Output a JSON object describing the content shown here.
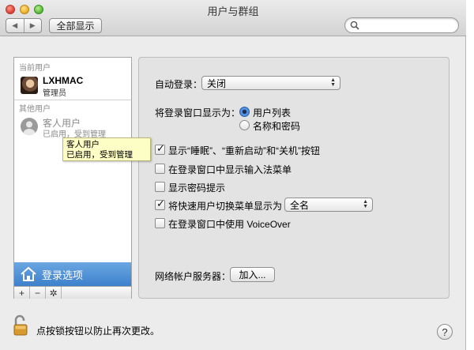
{
  "window": {
    "title": "用户与群组"
  },
  "toolbar": {
    "show_all": "全部显示",
    "back": "◀",
    "forward": "▶",
    "search_placeholder": ""
  },
  "sidebar": {
    "current_users_header": "当前用户",
    "current_user": {
      "name": "LXHMAC",
      "role": "管理员"
    },
    "other_users_header": "其他用户",
    "guest_user": {
      "name": "客人用户",
      "status": "已启用，受到管理"
    },
    "login_options": "登录选项",
    "add": "+",
    "remove": "−",
    "gear": "✲"
  },
  "tooltip": {
    "line1": "客人用户",
    "line2": "已启用，受到管理"
  },
  "panel": {
    "auto_login_label": "自动登录：",
    "auto_login_value": "关闭",
    "display_login_as_label": "将登录窗口显示为：",
    "radio_list_label": "用户列表",
    "radio_list_selected": true,
    "radio_name_label": "名称和密码",
    "opt_sleep_label": "显示“睡眠”、“重新启动”和“关机”按钮",
    "opt_sleep_checked": true,
    "opt_input_menu_label": "在登录窗口中显示输入法菜单",
    "opt_input_menu_checked": false,
    "opt_hints_label": "显示密码提示",
    "opt_hints_checked": false,
    "opt_fast_switch_label": "将快速用户切换菜单显示为",
    "opt_fast_switch_checked": true,
    "fast_switch_value": "全名",
    "opt_voiceover_label": "在登录窗口中使用 VoiceOver",
    "opt_voiceover_checked": false,
    "network_server_label": "网络帐户服务器：",
    "join_button": "加入..."
  },
  "footer": {
    "lock_text": "点按锁按钮以防止再次更改。",
    "help": "?"
  },
  "colors": {
    "selection": "#3d81cb",
    "tooltip_bg": "#fdfdc6",
    "panel_bg": "#e3e3e3"
  }
}
